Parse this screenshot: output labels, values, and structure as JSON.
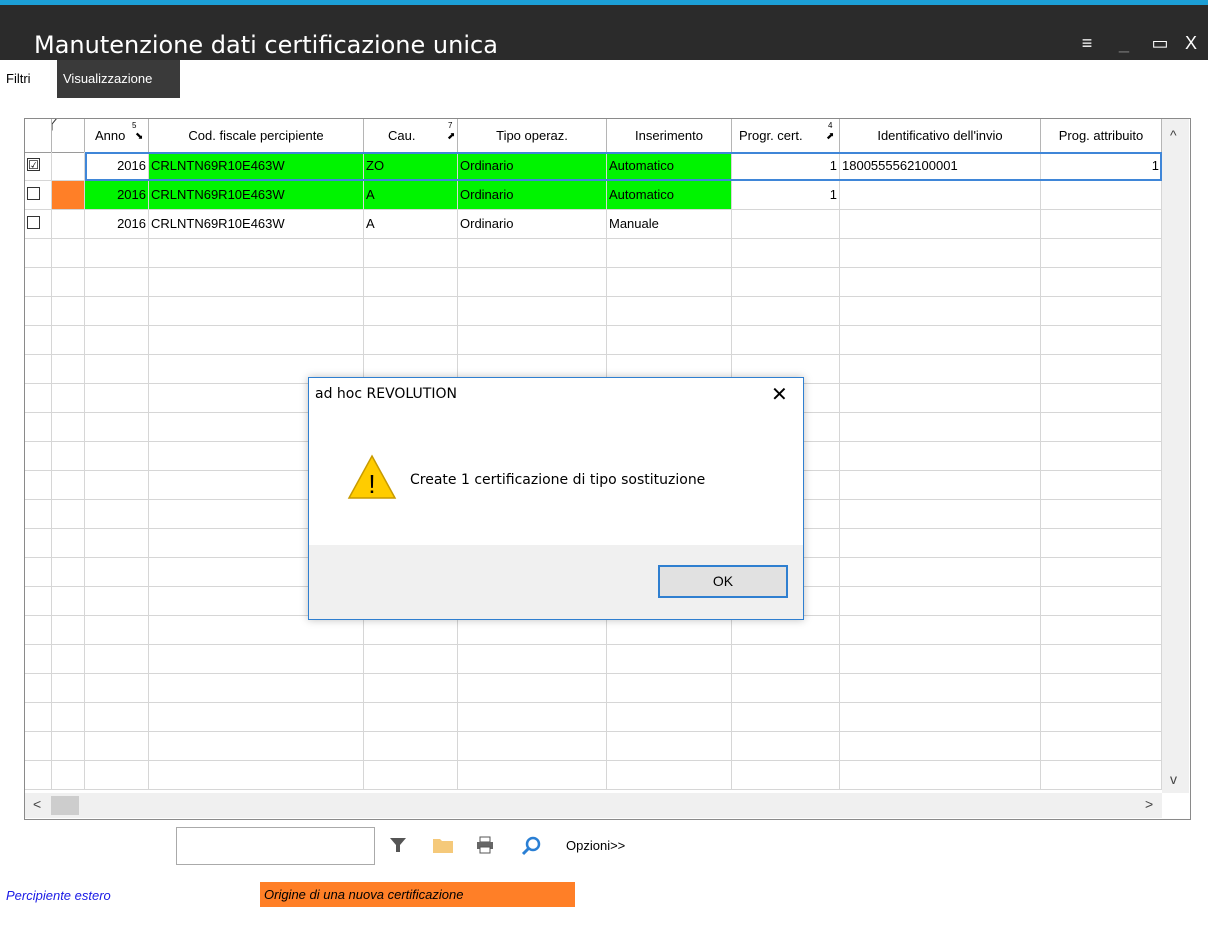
{
  "window": {
    "title": "Manutenzione dati certificazione unica",
    "menu_glyph": "≡",
    "minimize_glyph": "_",
    "maximize_glyph": "▭",
    "close_glyph": "X"
  },
  "tabs": [
    "Filtri",
    "Visualizzazione"
  ],
  "grid": {
    "columns": [
      {
        "label": "Anno",
        "sort_index": "5",
        "sort_dir": "desc"
      },
      {
        "label": "Cod. fiscale percipiente"
      },
      {
        "label": "Cau.",
        "sort_index": "7",
        "sort_dir": "asc"
      },
      {
        "label": "Tipo operaz."
      },
      {
        "label": "Inserimento"
      },
      {
        "label": "Progr. cert.",
        "sort_index": "4",
        "sort_dir": "asc"
      },
      {
        "label": "Identificativo dell'invio"
      },
      {
        "label": "Prog. attribuito"
      }
    ],
    "rows": [
      {
        "checked": true,
        "checkmark": "☑",
        "anno": "2016",
        "cf": "CRLNTN69R10E463W",
        "cau": "ZO",
        "tipo": "Ordinario",
        "ins": "Automatico",
        "progr": "1",
        "ident": "1800555562100001",
        "prog_attr": "1"
      },
      {
        "checked": false,
        "checkmark": "",
        "anno": "2016",
        "cf": "CRLNTN69R10E463W",
        "cau": "A",
        "tipo": "Ordinario",
        "ins": "Automatico",
        "progr": "1",
        "ident": "",
        "prog_attr": ""
      },
      {
        "checked": false,
        "checkmark": "",
        "anno": "2016",
        "cf": "CRLNTN69R10E463W",
        "cau": "A",
        "tipo": "Ordinario",
        "ins": "Manuale",
        "progr": "",
        "ident": "",
        "prog_attr": ""
      }
    ]
  },
  "toolbar": {
    "search_value": "",
    "options_label": "Opzioni>>"
  },
  "legend": {
    "foreign": "Percipiente estero",
    "new_cert_origin": "Origine di una nuova certificazione"
  },
  "dialog": {
    "title": "ad hoc REVOLUTION",
    "message": "Create 1 certificazione di tipo sostituzione",
    "ok_label": "OK",
    "close_glyph": "✕",
    "warning_glyph": "!"
  },
  "colors": {
    "accent": "#1c9fd6",
    "titlebar": "#2b2b2b",
    "highlight_green": "#00f400",
    "highlight_orange": "#ff7f27",
    "legend_blue": "#1a1ae6",
    "dialog_border": "#2f7fd0"
  },
  "icons": [
    "filter-icon",
    "folder-icon",
    "print-icon",
    "zoom-search-icon",
    "warning-icon"
  ]
}
